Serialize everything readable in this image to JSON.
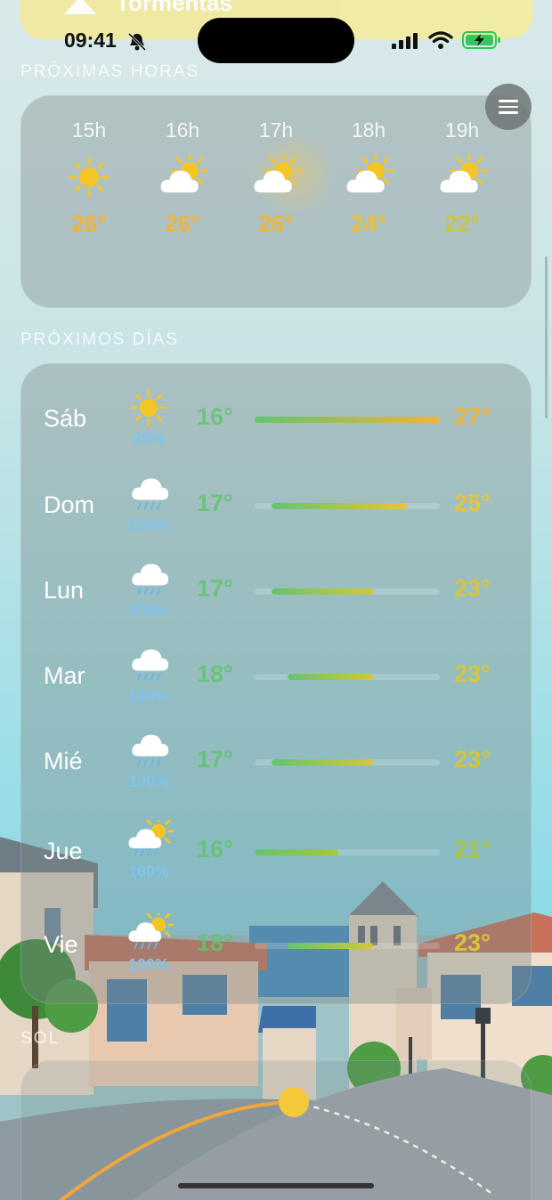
{
  "alert": {
    "text": "Tormentas",
    "icon": "warning-icon"
  },
  "status_bar": {
    "time": "09:41",
    "icons": [
      "bell-slash-icon",
      "signal-icon",
      "wifi-icon",
      "battery-charging-icon"
    ]
  },
  "hourly": {
    "section_title": "PRÓXIMAS HORAS",
    "hours": [
      {
        "label": "15h",
        "icon": "sun-icon",
        "temp": "26°",
        "color": "#f0b43a"
      },
      {
        "label": "16h",
        "icon": "partly-cloudy-icon",
        "temp": "26°",
        "color": "#f0b43a"
      },
      {
        "label": "17h",
        "icon": "partly-cloudy-icon",
        "temp": "26°",
        "color": "#f0b43a"
      },
      {
        "label": "18h",
        "icon": "partly-cloudy-icon",
        "temp": "24°",
        "color": "#e9c03a"
      },
      {
        "label": "19h",
        "icon": "partly-cloudy-icon",
        "temp": "22°",
        "color": "#c9c640"
      }
    ]
  },
  "daily": {
    "section_title": "PRÓXIMOS DÍAS",
    "days": [
      {
        "name": "Sáb",
        "icon": "sun-icon",
        "prob": "25%",
        "min": "16°",
        "max": "27°",
        "range_start": 0.0,
        "range_end": 1.0,
        "max_color": "#f0b43a"
      },
      {
        "name": "Dom",
        "icon": "rain-cloud-icon",
        "prob": "100%",
        "min": "17°",
        "max": "25°",
        "range_start": 0.09,
        "range_end": 0.82,
        "max_color": "#e8c43a"
      },
      {
        "name": "Lun",
        "icon": "rain-cloud-icon",
        "prob": "100%",
        "min": "17°",
        "max": "23°",
        "range_start": 0.09,
        "range_end": 0.64,
        "max_color": "#d4c63a"
      },
      {
        "name": "Mar",
        "icon": "rain-cloud-icon",
        "prob": "100%",
        "min": "18°",
        "max": "23°",
        "range_start": 0.18,
        "range_end": 0.64,
        "max_color": "#d4c63a"
      },
      {
        "name": "Mié",
        "icon": "rain-cloud-icon",
        "prob": "100%",
        "min": "17°",
        "max": "23°",
        "range_start": 0.09,
        "range_end": 0.64,
        "max_color": "#d4c63a"
      },
      {
        "name": "Jue",
        "icon": "sun-rain-cloud-icon",
        "prob": "100%",
        "min": "16°",
        "max": "21°",
        "range_start": 0.0,
        "range_end": 0.45,
        "max_color": "#a9c63e"
      },
      {
        "name": "Vie",
        "icon": "sun-rain-cloud-icon",
        "prob": "100%",
        "min": "18°",
        "max": "23°",
        "range_start": 0.18,
        "range_end": 0.64,
        "max_color": "#d4c63a"
      }
    ]
  },
  "sun": {
    "section_title": "SOL"
  },
  "colors": {
    "accent_orange": "#f0b43a",
    "min_green": "#62c56e",
    "rain_blue": "#7ec4ee"
  }
}
